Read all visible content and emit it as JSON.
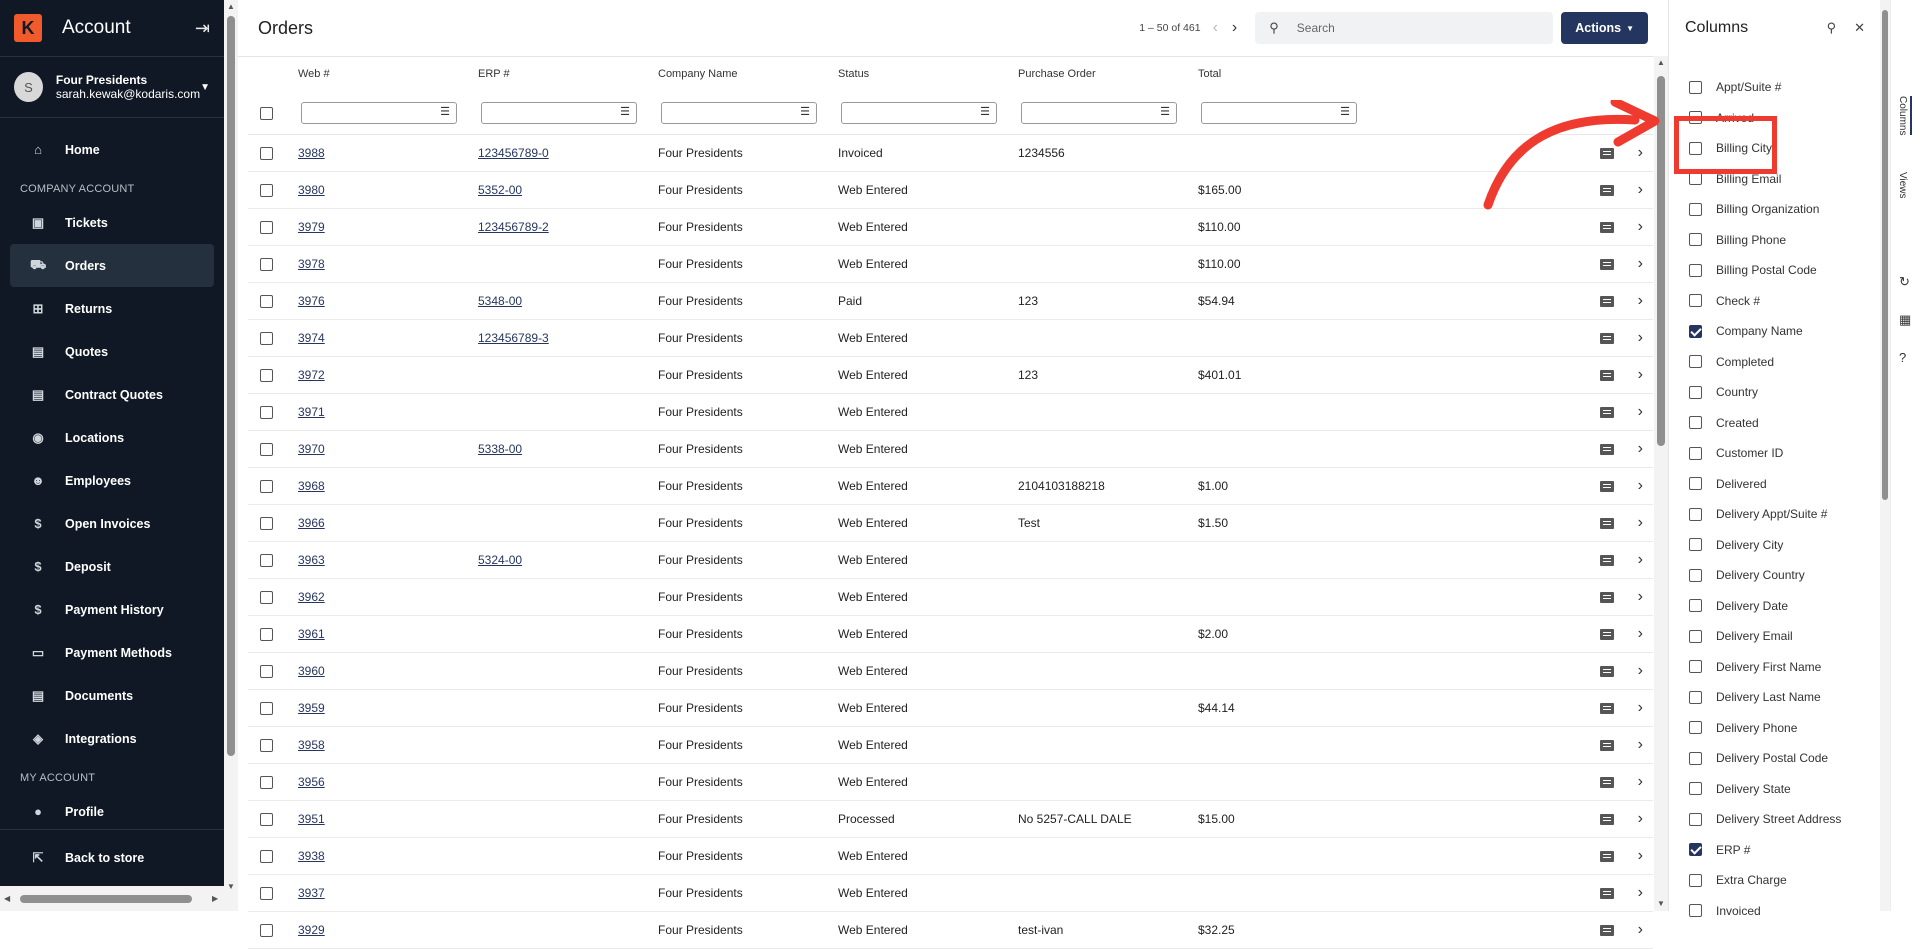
{
  "sidebar": {
    "app_title": "Account",
    "user": {
      "initial": "S",
      "name": "Four Presidents",
      "email": "sarah.kewak@kodaris.com"
    },
    "items_top": [
      {
        "label": "Home",
        "icon": "home-icon",
        "glyph": "⌂",
        "active": false
      }
    ],
    "section_company": "COMPANY ACCOUNT",
    "items_company": [
      {
        "label": "Tickets",
        "icon": "ticket-icon",
        "glyph": "▣",
        "active": false
      },
      {
        "label": "Orders",
        "icon": "truck-icon",
        "glyph": "⛟",
        "active": true
      },
      {
        "label": "Returns",
        "icon": "returns-icon",
        "glyph": "⊞",
        "active": false
      },
      {
        "label": "Quotes",
        "icon": "clipboard-icon",
        "glyph": "▤",
        "active": false
      },
      {
        "label": "Contract Quotes",
        "icon": "contract-icon",
        "glyph": "▤",
        "active": false
      },
      {
        "label": "Locations",
        "icon": "location-pin-icon",
        "glyph": "◉",
        "active": false
      },
      {
        "label": "Employees",
        "icon": "people-icon",
        "glyph": "☻",
        "active": false
      },
      {
        "label": "Open Invoices",
        "icon": "dollar-icon",
        "glyph": "$",
        "active": false
      },
      {
        "label": "Deposit",
        "icon": "dollar-icon",
        "glyph": "$",
        "active": false
      },
      {
        "label": "Payment History",
        "icon": "dollar-icon",
        "glyph": "$",
        "active": false
      },
      {
        "label": "Payment Methods",
        "icon": "credit-card-icon",
        "glyph": "▭",
        "active": false
      },
      {
        "label": "Documents",
        "icon": "document-icon",
        "glyph": "▤",
        "active": false
      },
      {
        "label": "Integrations",
        "icon": "integrations-icon",
        "glyph": "◈",
        "active": false
      }
    ],
    "section_my": "MY ACCOUNT",
    "items_my": [
      {
        "label": "Profile",
        "icon": "profile-icon",
        "glyph": "●",
        "active": false
      }
    ],
    "back_label": "Back to store"
  },
  "main": {
    "title": "Orders",
    "pager": "1 – 50 of 461",
    "search_placeholder": "Search",
    "actions_label": "Actions",
    "columns": {
      "web": "Web #",
      "erp": "ERP #",
      "company": "Company Name",
      "status": "Status",
      "po": "Purchase Order",
      "total": "Total"
    },
    "rows": [
      {
        "web": "3988",
        "erp": "123456789-0",
        "company": "Four Presidents",
        "status": "Invoiced",
        "po": "1234556",
        "total": ""
      },
      {
        "web": "3980",
        "erp": "5352-00",
        "company": "Four Presidents",
        "status": "Web Entered",
        "po": "",
        "total": "$165.00"
      },
      {
        "web": "3979",
        "erp": "123456789-2",
        "company": "Four Presidents",
        "status": "Web Entered",
        "po": "",
        "total": "$110.00"
      },
      {
        "web": "3978",
        "erp": "",
        "company": "Four Presidents",
        "status": "Web Entered",
        "po": "",
        "total": "$110.00"
      },
      {
        "web": "3976",
        "erp": "5348-00",
        "company": "Four Presidents",
        "status": "Paid",
        "po": "123",
        "total": "$54.94"
      },
      {
        "web": "3974",
        "erp": "123456789-3",
        "company": "Four Presidents",
        "status": "Web Entered",
        "po": "",
        "total": ""
      },
      {
        "web": "3972",
        "erp": "",
        "company": "Four Presidents",
        "status": "Web Entered",
        "po": "123",
        "total": "$401.01"
      },
      {
        "web": "3971",
        "erp": "",
        "company": "Four Presidents",
        "status": "Web Entered",
        "po": "",
        "total": ""
      },
      {
        "web": "3970",
        "erp": "5338-00",
        "company": "Four Presidents",
        "status": "Web Entered",
        "po": "",
        "total": ""
      },
      {
        "web": "3968",
        "erp": "",
        "company": "Four Presidents",
        "status": "Web Entered",
        "po": "2104103188218",
        "total": "$1.00"
      },
      {
        "web": "3966",
        "erp": "",
        "company": "Four Presidents",
        "status": "Web Entered",
        "po": "Test",
        "total": "$1.50"
      },
      {
        "web": "3963",
        "erp": "5324-00",
        "company": "Four Presidents",
        "status": "Web Entered",
        "po": "",
        "total": ""
      },
      {
        "web": "3962",
        "erp": "",
        "company": "Four Presidents",
        "status": "Web Entered",
        "po": "",
        "total": ""
      },
      {
        "web": "3961",
        "erp": "",
        "company": "Four Presidents",
        "status": "Web Entered",
        "po": "",
        "total": "$2.00"
      },
      {
        "web": "3960",
        "erp": "",
        "company": "Four Presidents",
        "status": "Web Entered",
        "po": "",
        "total": ""
      },
      {
        "web": "3959",
        "erp": "",
        "company": "Four Presidents",
        "status": "Web Entered",
        "po": "",
        "total": "$44.14"
      },
      {
        "web": "3958",
        "erp": "",
        "company": "Four Presidents",
        "status": "Web Entered",
        "po": "",
        "total": ""
      },
      {
        "web": "3956",
        "erp": "",
        "company": "Four Presidents",
        "status": "Web Entered",
        "po": "",
        "total": ""
      },
      {
        "web": "3951",
        "erp": "",
        "company": "Four Presidents",
        "status": "Processed",
        "po": "No 5257-CALL DALE",
        "total": "$15.00"
      },
      {
        "web": "3938",
        "erp": "",
        "company": "Four Presidents",
        "status": "Web Entered",
        "po": "",
        "total": ""
      },
      {
        "web": "3937",
        "erp": "",
        "company": "Four Presidents",
        "status": "Web Entered",
        "po": "",
        "total": ""
      },
      {
        "web": "3929",
        "erp": "",
        "company": "Four Presidents",
        "status": "Web Entered",
        "po": "test-ivan",
        "total": "$32.25"
      }
    ]
  },
  "panel": {
    "title": "Columns",
    "items": [
      {
        "label": "Appt/Suite #",
        "checked": false
      },
      {
        "label": "Arrived",
        "checked": false
      },
      {
        "label": "Billing City",
        "checked": false
      },
      {
        "label": "Billing Email",
        "checked": false
      },
      {
        "label": "Billing Organization",
        "checked": false
      },
      {
        "label": "Billing Phone",
        "checked": false
      },
      {
        "label": "Billing Postal Code",
        "checked": false
      },
      {
        "label": "Check #",
        "checked": false
      },
      {
        "label": "Company Name",
        "checked": true
      },
      {
        "label": "Completed",
        "checked": false
      },
      {
        "label": "Country",
        "checked": false
      },
      {
        "label": "Created",
        "checked": false
      },
      {
        "label": "Customer ID",
        "checked": false
      },
      {
        "label": "Delivered",
        "checked": false
      },
      {
        "label": "Delivery Appt/Suite #",
        "checked": false
      },
      {
        "label": "Delivery City",
        "checked": false
      },
      {
        "label": "Delivery Country",
        "checked": false
      },
      {
        "label": "Delivery Date",
        "checked": false
      },
      {
        "label": "Delivery Email",
        "checked": false
      },
      {
        "label": "Delivery First Name",
        "checked": false
      },
      {
        "label": "Delivery Last Name",
        "checked": false
      },
      {
        "label": "Delivery Phone",
        "checked": false
      },
      {
        "label": "Delivery Postal Code",
        "checked": false
      },
      {
        "label": "Delivery State",
        "checked": false
      },
      {
        "label": "Delivery Street Address",
        "checked": false
      },
      {
        "label": "ERP #",
        "checked": true
      },
      {
        "label": "Extra Charge",
        "checked": false
      },
      {
        "label": "Invoiced",
        "checked": false
      }
    ]
  },
  "rail": {
    "tab_columns": "Columns",
    "tab_views": "Views"
  },
  "colors": {
    "sidebar_bg": "#0f1824",
    "accent": "#243660",
    "annotation": "#ee3a2f",
    "logo": "#f15a2b"
  }
}
